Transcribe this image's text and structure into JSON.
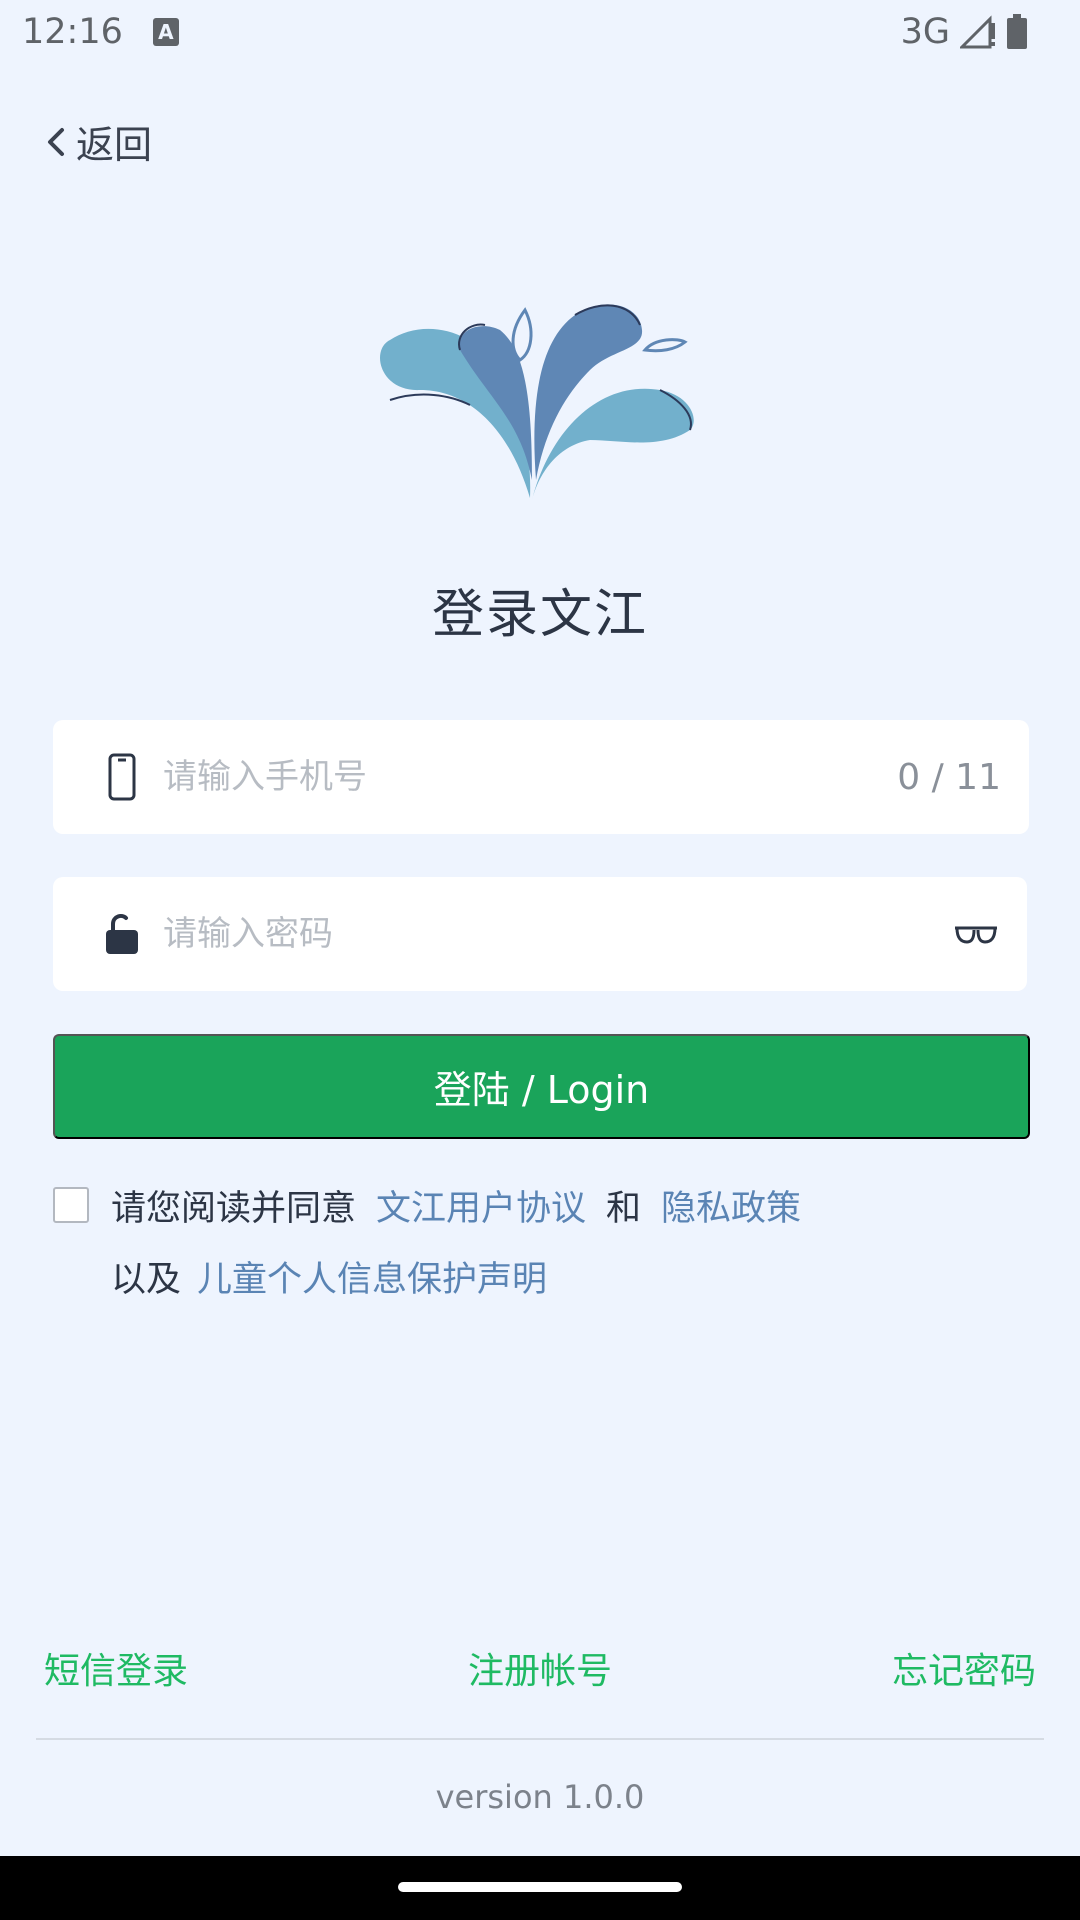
{
  "status_bar": {
    "time": "12:16",
    "notification_icon": "A",
    "network": "3G"
  },
  "nav": {
    "back_label": "返回"
  },
  "app": {
    "title": "登录文江"
  },
  "phone_field": {
    "placeholder": "请输入手机号",
    "value": "",
    "counter": "0 / 11"
  },
  "password_field": {
    "placeholder": "请输入密码",
    "value": ""
  },
  "login_button": {
    "label": "登陆  /  Login"
  },
  "agreement": {
    "prefix": "请您阅读并同意",
    "user_agreement": "文江用户协议",
    "and": "和",
    "privacy_policy": "隐私政策",
    "also": "以及",
    "child_policy": "儿童个人信息保护声明"
  },
  "bottom_links": {
    "sms_login": "短信登录",
    "register": "注册帐号",
    "forgot": "忘记密码"
  },
  "version": "version 1.0.0",
  "colors": {
    "background": "#eef4fe",
    "primary_green": "#1aa45a",
    "link_blue": "#5a84b4",
    "bottom_link_green": "#1fba63"
  }
}
